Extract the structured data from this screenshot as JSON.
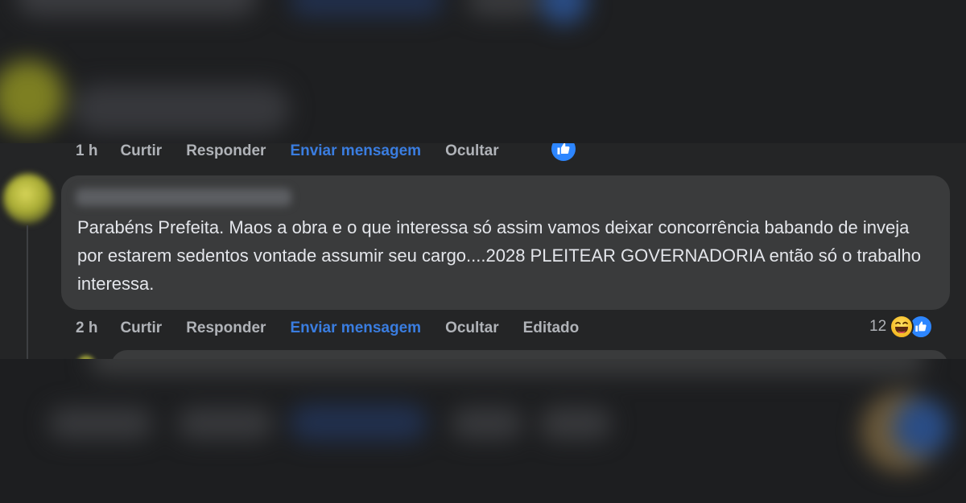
{
  "previous_comment": {
    "time": "1 h",
    "like_label": "Curtir",
    "reply_label": "Responder",
    "message_label": "Enviar mensagem",
    "hide_label": "Ocultar",
    "reaction_icon": "like-icon"
  },
  "comment": {
    "author": "",
    "text": "Parabéns Prefeita. Maos a obra e o que interessa só assim vamos deixar concorrência babando de inveja por estarem sedentos vontade assumir seu cargo....2028 PLEITEAR GOVERNADORIA então só o trabalho interessa.",
    "time": "2 h",
    "like_label": "Curtir",
    "reply_label": "Responder",
    "message_label": "Enviar mensagem",
    "hide_label": "Ocultar",
    "edited_label": "Editado",
    "reaction_count": "12",
    "reaction_icons": [
      "haha-icon",
      "like-icon"
    ]
  },
  "colors": {
    "background": "#242526",
    "bubble": "#3a3b3c",
    "text": "#e4e6eb",
    "muted": "#b0b3b8",
    "link": "#3a7de0",
    "like_blue": "#2d86ff"
  }
}
